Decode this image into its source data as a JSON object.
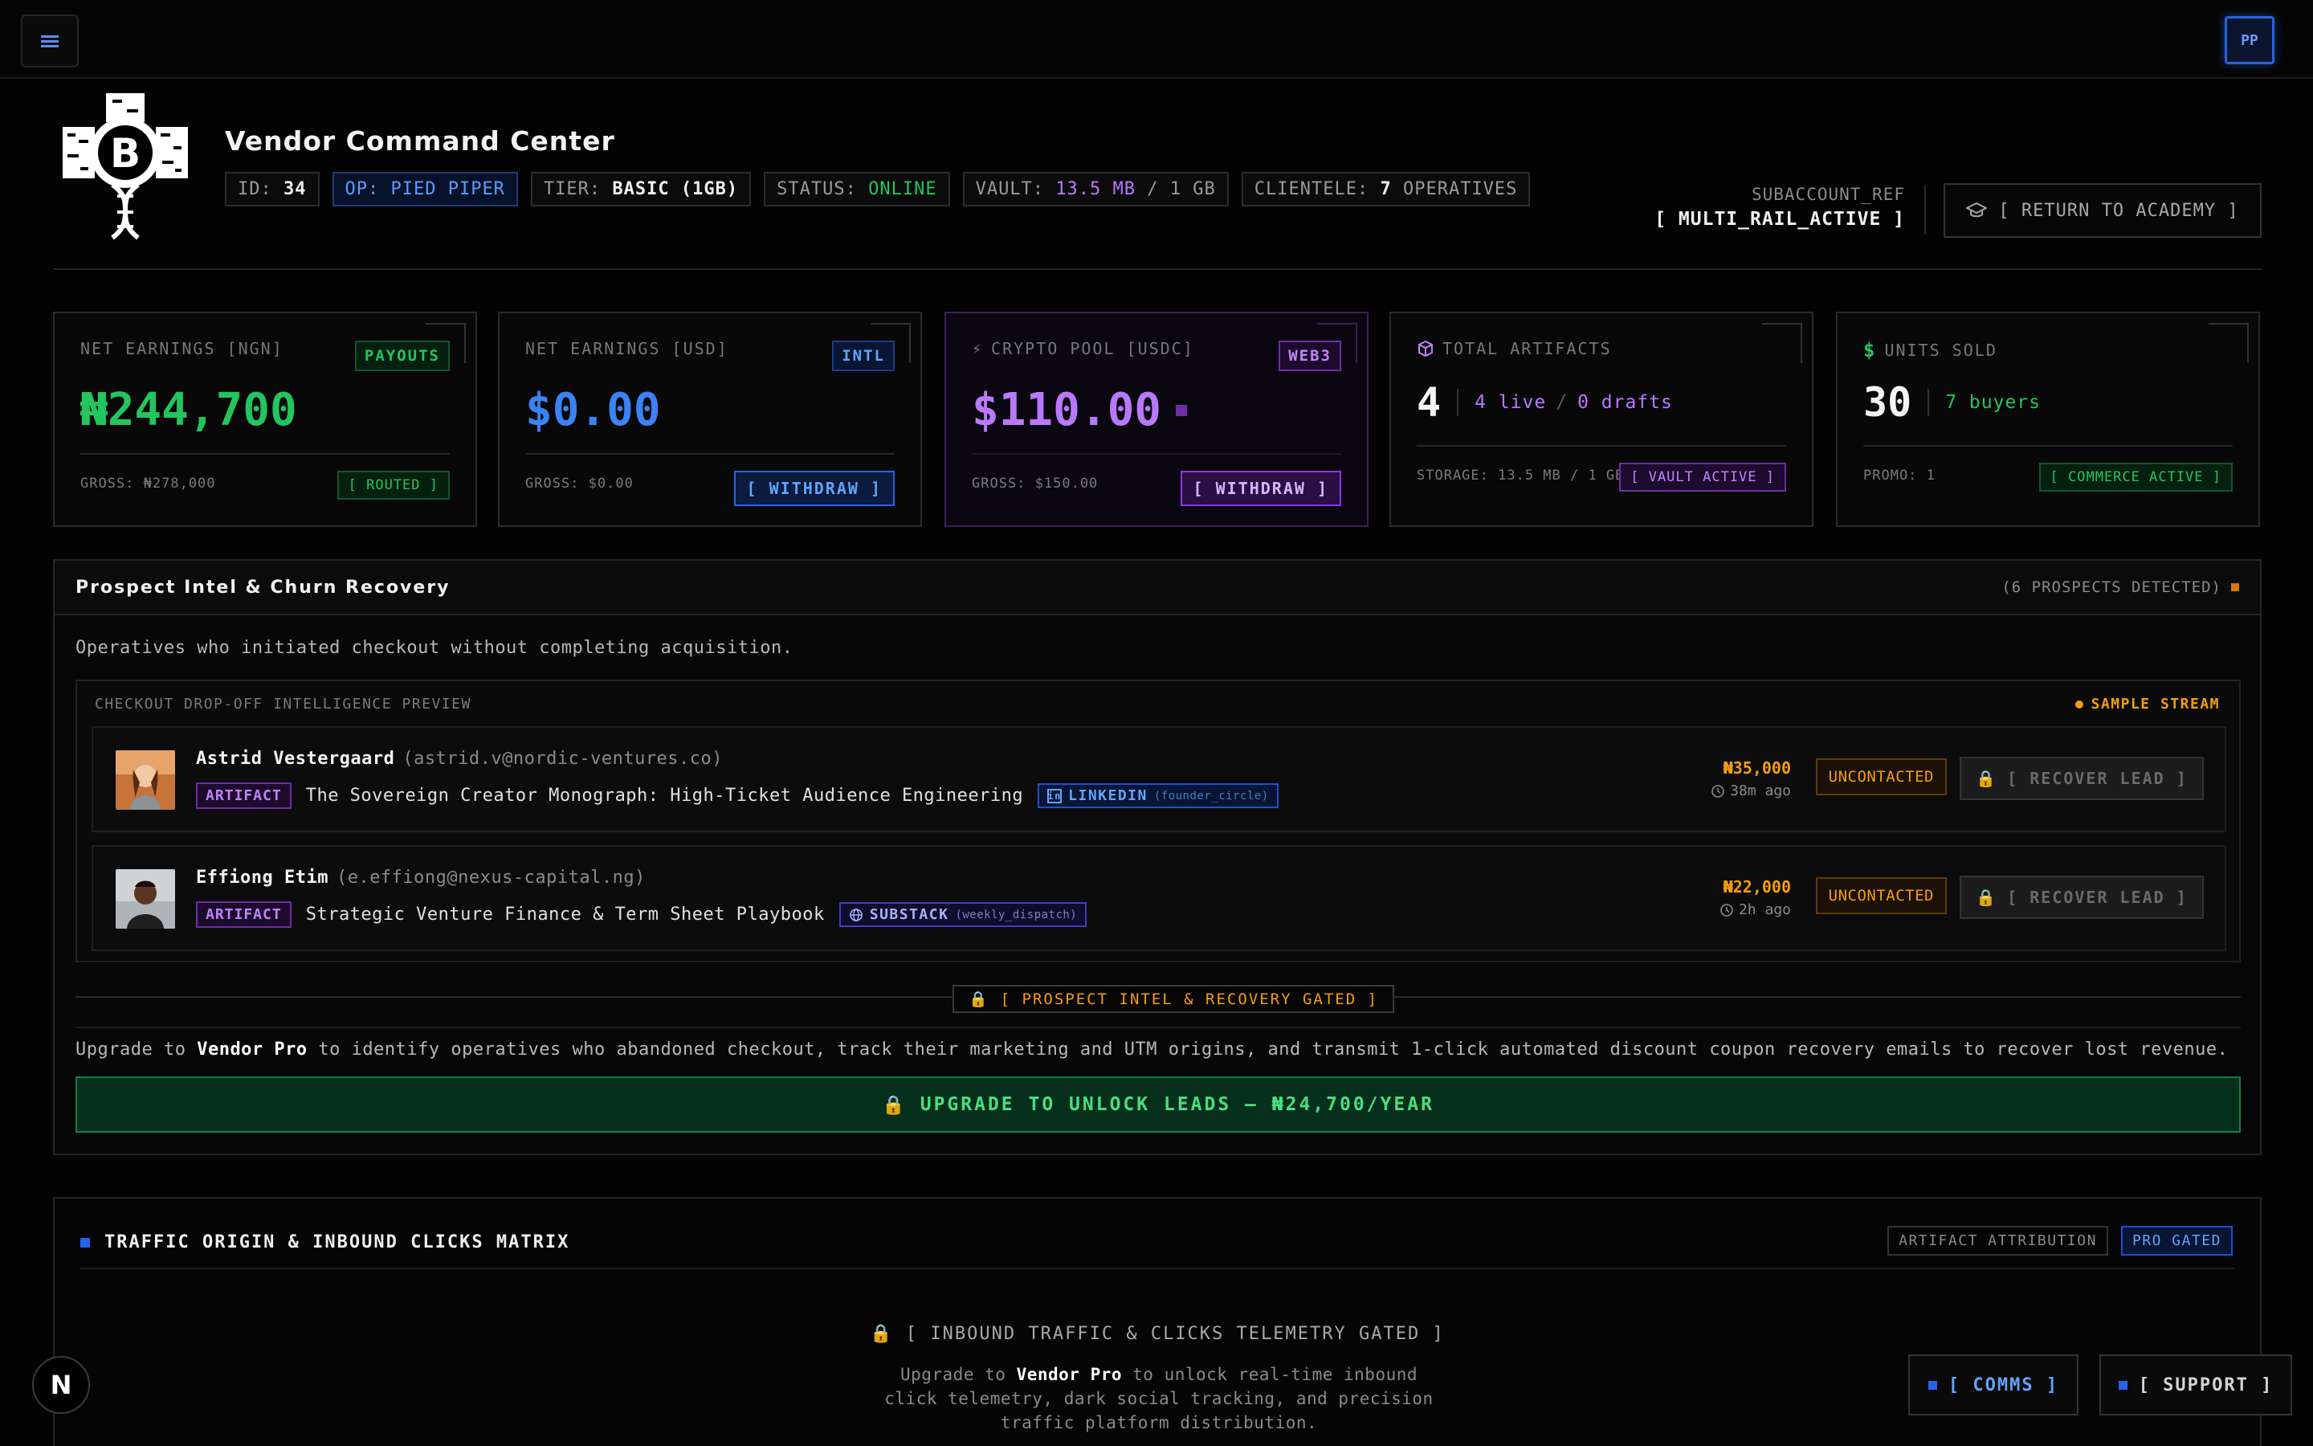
{
  "topbar": {
    "menu_icon": "hamburger-icon",
    "avatar": "PP"
  },
  "header": {
    "title": "Vendor Command Center",
    "chips": [
      {
        "label": "ID:",
        "value": "34"
      },
      {
        "label": "OP: PIED PIPER"
      },
      {
        "label": "TIER:",
        "value": "BASIC (1GB)"
      },
      {
        "label": "STATUS:",
        "value": "ONLINE"
      },
      {
        "label": "VAULT:",
        "value": "13.5 MB",
        "suffix": "/ 1 GB"
      },
      {
        "label": "CLIENTELE:",
        "value": "7",
        "suffix": "OPERATIVES"
      }
    ],
    "subaccount_label": "SUBACCOUNT_REF",
    "subaccount_value": "[ MULTI_RAIL_ACTIVE ]",
    "return_label": "[ RETURN TO ACADEMY ]"
  },
  "cards": {
    "ngn": {
      "label": "NET EARNINGS [NGN]",
      "tag": "PAYOUTS",
      "amount": "₦244,700",
      "gross": "GROSS: ₦278,000",
      "pill": "[ ROUTED ]"
    },
    "usd": {
      "label": "NET EARNINGS [USD]",
      "tag": "INTL",
      "amount": "$0.00",
      "gross": "GROSS: $0.00",
      "button": "[ WITHDRAW ]"
    },
    "crypto": {
      "label": "CRYPTO POOL [USDC]",
      "tag": "WEB3",
      "amount": "$110.00",
      "gross": "GROSS: $150.00",
      "button": "[ WITHDRAW ]"
    },
    "artifacts": {
      "label": "TOTAL ARTIFACTS",
      "count": "4",
      "sub_live": "4 live",
      "sub_sep": "/",
      "sub_drafts": "0 drafts",
      "storage": "STORAGE: 13.5 MB / 1 GB",
      "pill": "[ VAULT ACTIVE ]"
    },
    "units": {
      "label": "UNITS SOLD",
      "count": "30",
      "sub": "7 buyers",
      "promo": "PROMO: 1",
      "pill": "[ COMMERCE ACTIVE ]"
    }
  },
  "prospects": {
    "title": "Prospect Intel & Churn Recovery",
    "detected": "(6 PROSPECTS DETECTED)",
    "description": "Operatives who initiated checkout without completing acquisition.",
    "preview_label": "CHECKOUT DROP-OFF INTELLIGENCE PREVIEW",
    "stream_label": "SAMPLE STREAM",
    "leads": [
      {
        "name": "Astrid Vestergaard",
        "email": "(astrid.v@nordic-ventures.co)",
        "tag": "ARTIFACT",
        "artifact": "The Sovereign Creator Monograph: High-Ticket Audience Engineering",
        "source": "LINKEDIN",
        "handle": "(founder_circle)",
        "amount": "₦35,000",
        "ago": "38m ago",
        "status": "UNCONTACTED",
        "action": "[ RECOVER LEAD ]"
      },
      {
        "name": "Effiong Etim",
        "email": "(e.effiong@nexus-capital.ng)",
        "tag": "ARTIFACT",
        "artifact": "Strategic Venture Finance & Term Sheet Playbook",
        "source": "SUBSTACK",
        "handle": "(weekly_dispatch)",
        "amount": "₦22,000",
        "ago": "2h ago",
        "status": "UNCONTACTED",
        "action": "[ RECOVER LEAD ]"
      }
    ],
    "gated_badge": "[ PROSPECT INTEL & RECOVERY GATED ]",
    "upgrade_prefix": "Upgrade to",
    "upgrade_brand": "Vendor Pro",
    "upgrade_suffix": "to identify operatives who abandoned checkout, track their marketing and UTM origins, and transmit 1-click automated discount coupon recovery emails to recover lost revenue.",
    "unlock_button": "UPGRADE TO UNLOCK LEADS — ₦24,700/YEAR"
  },
  "traffic": {
    "title": "TRAFFIC ORIGIN & INBOUND CLICKS MATRIX",
    "tag_attr": "ARTIFACT ATTRIBUTION",
    "tag_pro": "PRO GATED",
    "gated": "[ INBOUND TRAFFIC & CLICKS TELEMETRY GATED ]",
    "desc_prefix": "Upgrade to",
    "desc_brand": "Vendor Pro",
    "desc_suffix": "to unlock real-time inbound click telemetry, dark social tracking, and precision traffic platform distribution."
  },
  "floating": {
    "n_logo": "N",
    "comms": "[ COMMS ]",
    "support": "[ SUPPORT ]"
  },
  "colors": {
    "green": "#22c55e",
    "blue": "#3b82f6",
    "purple": "#b879ff",
    "amber": "#f59e0b"
  }
}
